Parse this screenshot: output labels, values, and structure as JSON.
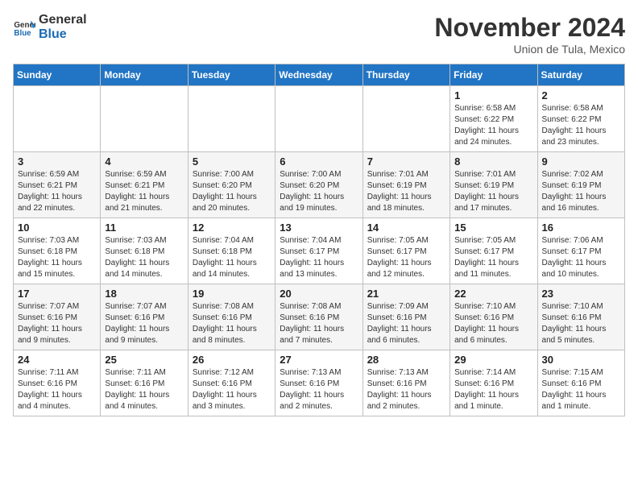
{
  "logo": {
    "general": "General",
    "blue": "Blue"
  },
  "header": {
    "month": "November 2024",
    "location": "Union de Tula, Mexico"
  },
  "weekdays": [
    "Sunday",
    "Monday",
    "Tuesday",
    "Wednesday",
    "Thursday",
    "Friday",
    "Saturday"
  ],
  "weeks": [
    [
      {
        "day": "",
        "info": ""
      },
      {
        "day": "",
        "info": ""
      },
      {
        "day": "",
        "info": ""
      },
      {
        "day": "",
        "info": ""
      },
      {
        "day": "",
        "info": ""
      },
      {
        "day": "1",
        "info": "Sunrise: 6:58 AM\nSunset: 6:22 PM\nDaylight: 11 hours and 24 minutes."
      },
      {
        "day": "2",
        "info": "Sunrise: 6:58 AM\nSunset: 6:22 PM\nDaylight: 11 hours and 23 minutes."
      }
    ],
    [
      {
        "day": "3",
        "info": "Sunrise: 6:59 AM\nSunset: 6:21 PM\nDaylight: 11 hours and 22 minutes."
      },
      {
        "day": "4",
        "info": "Sunrise: 6:59 AM\nSunset: 6:21 PM\nDaylight: 11 hours and 21 minutes."
      },
      {
        "day": "5",
        "info": "Sunrise: 7:00 AM\nSunset: 6:20 PM\nDaylight: 11 hours and 20 minutes."
      },
      {
        "day": "6",
        "info": "Sunrise: 7:00 AM\nSunset: 6:20 PM\nDaylight: 11 hours and 19 minutes."
      },
      {
        "day": "7",
        "info": "Sunrise: 7:01 AM\nSunset: 6:19 PM\nDaylight: 11 hours and 18 minutes."
      },
      {
        "day": "8",
        "info": "Sunrise: 7:01 AM\nSunset: 6:19 PM\nDaylight: 11 hours and 17 minutes."
      },
      {
        "day": "9",
        "info": "Sunrise: 7:02 AM\nSunset: 6:19 PM\nDaylight: 11 hours and 16 minutes."
      }
    ],
    [
      {
        "day": "10",
        "info": "Sunrise: 7:03 AM\nSunset: 6:18 PM\nDaylight: 11 hours and 15 minutes."
      },
      {
        "day": "11",
        "info": "Sunrise: 7:03 AM\nSunset: 6:18 PM\nDaylight: 11 hours and 14 minutes."
      },
      {
        "day": "12",
        "info": "Sunrise: 7:04 AM\nSunset: 6:18 PM\nDaylight: 11 hours and 14 minutes."
      },
      {
        "day": "13",
        "info": "Sunrise: 7:04 AM\nSunset: 6:17 PM\nDaylight: 11 hours and 13 minutes."
      },
      {
        "day": "14",
        "info": "Sunrise: 7:05 AM\nSunset: 6:17 PM\nDaylight: 11 hours and 12 minutes."
      },
      {
        "day": "15",
        "info": "Sunrise: 7:05 AM\nSunset: 6:17 PM\nDaylight: 11 hours and 11 minutes."
      },
      {
        "day": "16",
        "info": "Sunrise: 7:06 AM\nSunset: 6:17 PM\nDaylight: 11 hours and 10 minutes."
      }
    ],
    [
      {
        "day": "17",
        "info": "Sunrise: 7:07 AM\nSunset: 6:16 PM\nDaylight: 11 hours and 9 minutes."
      },
      {
        "day": "18",
        "info": "Sunrise: 7:07 AM\nSunset: 6:16 PM\nDaylight: 11 hours and 9 minutes."
      },
      {
        "day": "19",
        "info": "Sunrise: 7:08 AM\nSunset: 6:16 PM\nDaylight: 11 hours and 8 minutes."
      },
      {
        "day": "20",
        "info": "Sunrise: 7:08 AM\nSunset: 6:16 PM\nDaylight: 11 hours and 7 minutes."
      },
      {
        "day": "21",
        "info": "Sunrise: 7:09 AM\nSunset: 6:16 PM\nDaylight: 11 hours and 6 minutes."
      },
      {
        "day": "22",
        "info": "Sunrise: 7:10 AM\nSunset: 6:16 PM\nDaylight: 11 hours and 6 minutes."
      },
      {
        "day": "23",
        "info": "Sunrise: 7:10 AM\nSunset: 6:16 PM\nDaylight: 11 hours and 5 minutes."
      }
    ],
    [
      {
        "day": "24",
        "info": "Sunrise: 7:11 AM\nSunset: 6:16 PM\nDaylight: 11 hours and 4 minutes."
      },
      {
        "day": "25",
        "info": "Sunrise: 7:11 AM\nSunset: 6:16 PM\nDaylight: 11 hours and 4 minutes."
      },
      {
        "day": "26",
        "info": "Sunrise: 7:12 AM\nSunset: 6:16 PM\nDaylight: 11 hours and 3 minutes."
      },
      {
        "day": "27",
        "info": "Sunrise: 7:13 AM\nSunset: 6:16 PM\nDaylight: 11 hours and 2 minutes."
      },
      {
        "day": "28",
        "info": "Sunrise: 7:13 AM\nSunset: 6:16 PM\nDaylight: 11 hours and 2 minutes."
      },
      {
        "day": "29",
        "info": "Sunrise: 7:14 AM\nSunset: 6:16 PM\nDaylight: 11 hours and 1 minute."
      },
      {
        "day": "30",
        "info": "Sunrise: 7:15 AM\nSunset: 6:16 PM\nDaylight: 11 hours and 1 minute."
      }
    ]
  ]
}
